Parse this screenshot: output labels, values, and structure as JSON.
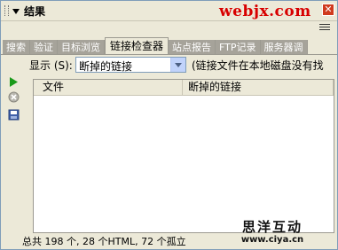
{
  "panel": {
    "title": "结果",
    "watermark": "webjx.com",
    "close_glyph": "✕"
  },
  "tabs": [
    {
      "label": "搜索",
      "active": false
    },
    {
      "label": "验证",
      "active": false
    },
    {
      "label": "目标浏览",
      "active": false
    },
    {
      "label": "链接检查器",
      "active": true
    },
    {
      "label": "站点报告",
      "active": false
    },
    {
      "label": "FTP记录",
      "active": false
    },
    {
      "label": "服务器调",
      "active": false
    }
  ],
  "toolbar": {
    "show_label": "显示 (S):",
    "show_value": "断掉的链接",
    "hint": "(链接文件在本地磁盘没有找"
  },
  "table": {
    "columns": [
      "文件",
      "断掉的链接"
    ],
    "rows": []
  },
  "status": {
    "text": "总共 198 个, 28 个HTML, 72 个孤立"
  },
  "logo": {
    "name": "思洋互动",
    "url": "www.ciya.cn"
  },
  "icons": {
    "run": "play-icon",
    "stop": "stop-icon",
    "save": "save-icon",
    "options": "options-menu-icon"
  },
  "colors": {
    "watermark": "#d80000",
    "close": "#d03a1e",
    "run": "#1a9a1a"
  }
}
